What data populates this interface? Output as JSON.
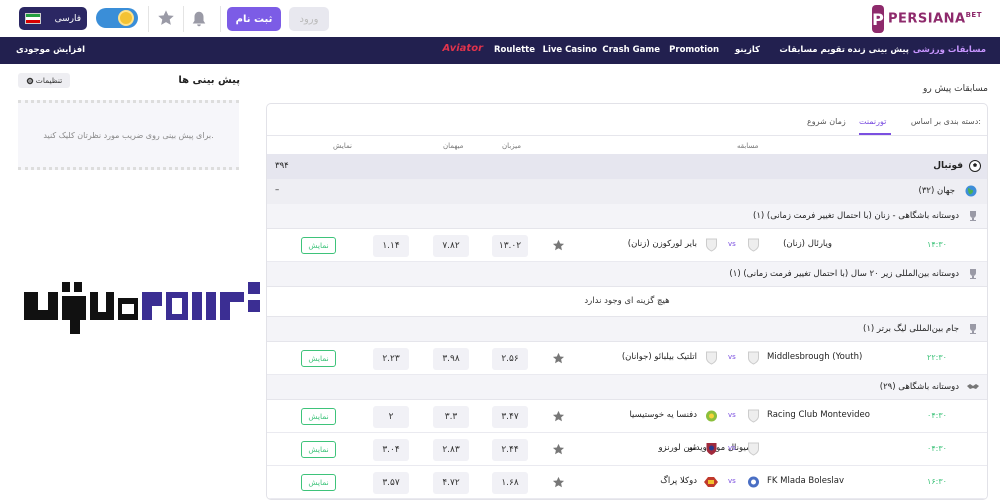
{
  "header": {
    "logo_text": "PERSIANA",
    "logo_sup": "BET",
    "login_label": "ورود",
    "register_label": "ثبت نام",
    "language_label": "فارسی"
  },
  "nav": {
    "items": [
      {
        "label": "مسابقات ورزشی"
      },
      {
        "label": "پیش بینی زنده"
      },
      {
        "label": "تقویم مسابقات"
      },
      {
        "label": "کازینو"
      },
      {
        "label": "Promotion"
      },
      {
        "label": "Crash Game"
      },
      {
        "label": "Live Casino"
      },
      {
        "label": "Roulette"
      },
      {
        "label": "Aviator"
      }
    ],
    "balance_label": "افزایش موجودی"
  },
  "left_panel": {
    "title": "پیش بینی ها",
    "settings_label": "تنظیمات",
    "empty_text": "برای پیش بینی روی ضریب مورد نظرتان کلیک کنید."
  },
  "main": {
    "title": "مسابقات پیش رو",
    "sort_label": "دسته بندی بر اساس:",
    "sort_tabs": [
      "تورنمنت",
      "زمان شروع"
    ],
    "columns": {
      "match": "مسابقه",
      "home": "میزبان",
      "away": "میهمان",
      "show": "نمایش"
    },
    "sport": {
      "name": "فوتبال",
      "count": "۳۹۴"
    },
    "region": {
      "name": "جهان (۳۲)",
      "toggle": "–"
    },
    "leagues": [
      {
        "name": "دوستانه باشگاهی - زنان (با احتمال تغییر فرمت زمانی) (۱)"
      },
      {
        "name": "دوستانه بین‌المللی زیر ۲۰ سال (با احتمال تغییر فرمت زمانی) (۱)"
      },
      {
        "name": "جام بین‌المللی لیگ برتر (۱)"
      },
      {
        "name": "دوستانه باشگاهی (۲۹)"
      }
    ],
    "empty_text": "هیچ گزینه ای وجود ندارد",
    "vs_label": "vs",
    "show_label": "نمایش",
    "matches": [
      {
        "time": "۱۴:۳۰",
        "home": "ویارئال (زنان)",
        "away": "بایر لورکوزن (زنان)",
        "odd1": "۱۳.۰۲",
        "oddx": "۷.۸۲",
        "odd2": "۱.۱۴"
      },
      {
        "time": "۲۲:۳۰",
        "home": "Middlesbrough (Youth)",
        "away": "اتلتیک بیلبائو (جوانان)",
        "odd1": "۲.۵۶",
        "oddx": "۳.۹۸",
        "odd2": "۲.۲۳"
      },
      {
        "time": "۰۴:۳۰",
        "home": "Racing Club Montevideo",
        "away": "دفنسا یه خوستیسیا",
        "odd1": "۳.۴۷",
        "oddx": "۳.۳",
        "odd2": "۲"
      },
      {
        "time": "۰۴:۳۰",
        "home": "ناسیونال مونته‌ویدئو",
        "away": "سن لورنزو",
        "odd1": "۲.۴۴",
        "oddx": "۲.۸۳",
        "odd2": "۳.۰۴"
      },
      {
        "time": "۱۶:۳۰",
        "home": "FK Mlada Boleslav",
        "away": "دوکلا پراگ",
        "odd1": "۱.۶۸",
        "oddx": "۴.۷۲",
        "odd2": "۳.۵۷"
      }
    ]
  },
  "colors": {
    "brand": "#8e2a6c",
    "nav_bg": "#22204f",
    "accent": "#7b4fe0",
    "green": "#3ec37a"
  }
}
